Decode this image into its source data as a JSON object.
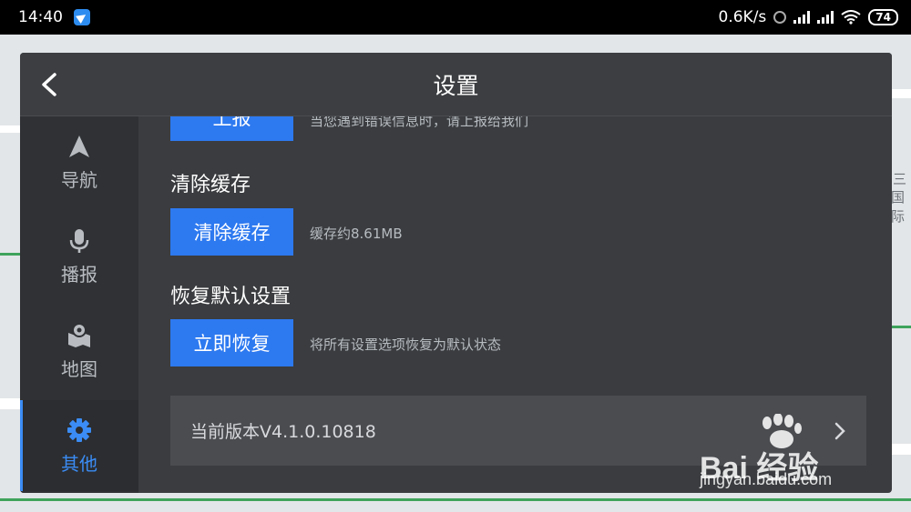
{
  "status_bar": {
    "time": "14:40",
    "network_speed": "0.6K/s",
    "battery_level": "74",
    "app_icon": "navigation-app-icon"
  },
  "header": {
    "title": "设置",
    "back_icon": "chevron-left-icon"
  },
  "sidebar": {
    "items": [
      {
        "label": "导航",
        "icon": "navigation-arrow-icon",
        "active": false
      },
      {
        "label": "播报",
        "icon": "microphone-icon",
        "active": false
      },
      {
        "label": "地图",
        "icon": "map-pin-icon",
        "active": false
      },
      {
        "label": "其他",
        "icon": "gear-icon",
        "active": true
      }
    ]
  },
  "sections": {
    "report": {
      "button_label": "上报",
      "description": "当您遇到错误信息时，请上报给我们"
    },
    "clear_cache": {
      "title": "清除缓存",
      "button_label": "清除缓存",
      "description": "缓存约8.61MB"
    },
    "restore_defaults": {
      "title": "恢复默认设置",
      "button_label": "立即恢复",
      "description": "将所有设置选项恢复为默认状态"
    }
  },
  "version": {
    "label": "当前版本V4.1.0.10818",
    "chevron_icon": "chevron-right-icon"
  },
  "watermark": {
    "brand": "Bai 经验",
    "url": "jingyan.baidu.com"
  },
  "map_labels": [
    "三",
    "国际"
  ],
  "colors": {
    "accent": "#2d79f0",
    "active_nav": "#3b8cf5",
    "dialog_bg": "#3a3c3f"
  }
}
